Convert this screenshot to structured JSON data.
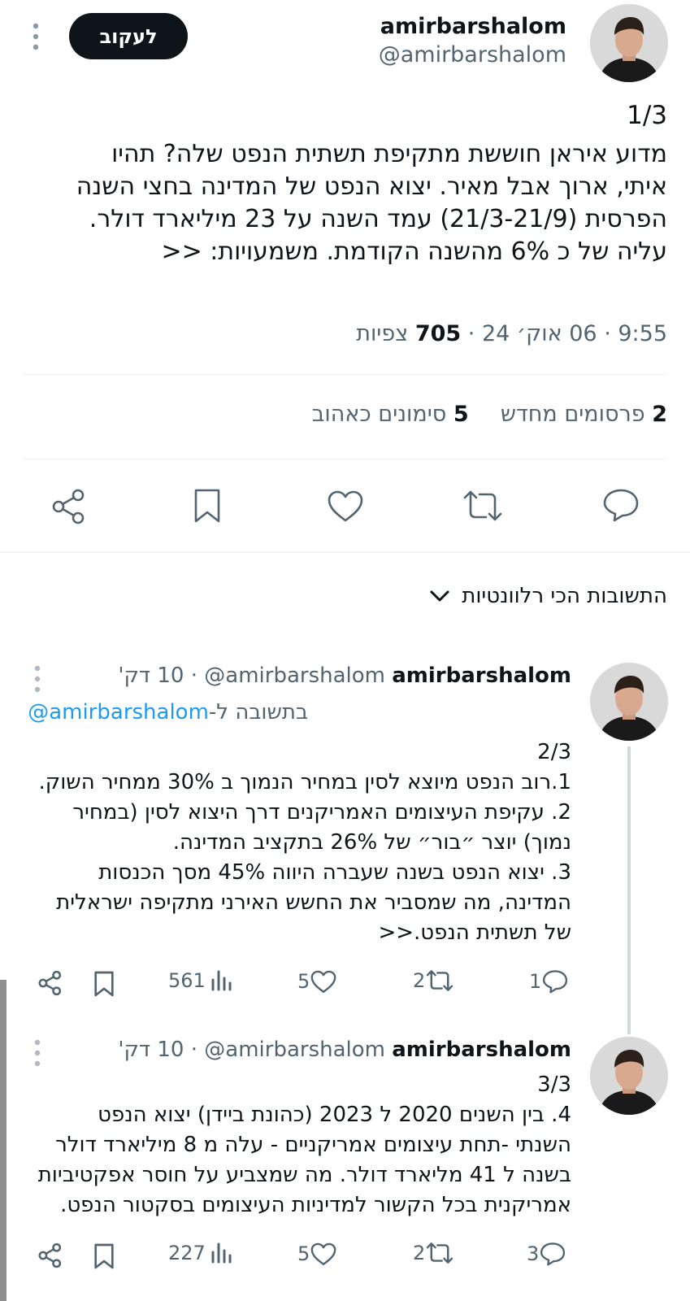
{
  "main_tweet": {
    "author_name": "amirbarshalom",
    "author_handle": "@amirbarshalom",
    "follow_label": "לעקוב",
    "numbering": "1/3",
    "lines": [
      "מדוע איראן חוששת מתקיפת תשתית הנפט שלה? תהיו",
      "איתי, ארוך אבל מאיר. יצוא הנפט של המדינה בחצי השנה",
      "הפרסית (21/3-21/9) עמד השנה על 23 מיליארד דולר.",
      "עליה של כ 6% מהשנה הקודמת. משמעויות: <<"
    ],
    "meta_time": "9:55 · 06 אוק׳ 24 · ",
    "meta_views_count": "705",
    "meta_views_label": " צפיות",
    "reposts_count": "2",
    "reposts_label": "פרסומים מחדש",
    "likes_count": "5",
    "likes_label": "סימונים כאהוב"
  },
  "replies_header": {
    "label": "התשובות הכי רלוונטיות"
  },
  "reply1": {
    "author_name": "amirbarshalom",
    "author_handle": "@amirbarshalom",
    "time": " · 10 דק'",
    "replying_to_prefix": "בתשובה ל-",
    "replying_to_handle": "@amirbarshalom",
    "numbering": "2/3",
    "lines": [
      "1.רוב הנפט מיוצא לסין במחיר הנמוך ב 30% ממחיר השוק.",
      "2. עקיפת העיצומים  האמריקנים דרך היצוא לסין (במחיר",
      "נמוך) יוצר ״בור״  של 26% בתקציב המדינה.",
      "3. יצוא הנפט בשנה שעברה היווה 45% מסך הכנסות",
      "המדינה,  מה שמסביר את החשש האירני מתקיפה ישראלית",
      "של תשתית הנפט.<<"
    ],
    "replies": "1",
    "reposts": "2",
    "likes": "5",
    "views": "561"
  },
  "reply2": {
    "author_name": "amirbarshalom",
    "author_handle": "@amirbarshalom",
    "time": " · 10 דק'",
    "numbering": "3/3",
    "lines": [
      "4. בין השנים 2020 ל 2023 (כהונת ביידן) יצוא הנפט",
      "השנתי -תחת עיצומים אמריקניים - עלה מ 8 מיליארד דולר",
      "בשנה ל 41 מליארד דולר. מה שמצביע על חוסר אפקטיביות",
      "אמריקנית בכל הקשור למדיניות העיצומים בסקטור הנפט."
    ],
    "replies": "3",
    "reposts": "2",
    "likes": "5",
    "views": "227"
  },
  "colors": {
    "text": "#0f1419",
    "secondary": "#536471",
    "link": "#1d9bf0",
    "divider": "#eff3f4",
    "thread_line": "#cfd9de"
  }
}
